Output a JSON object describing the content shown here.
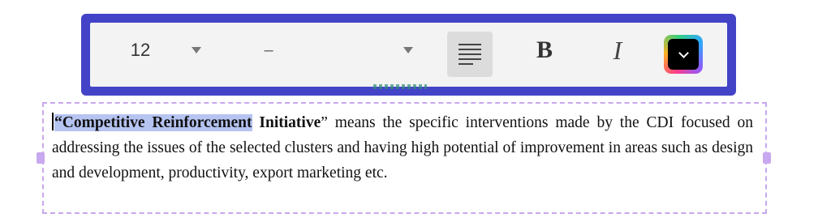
{
  "toolbar": {
    "font_size": "12",
    "font_family": "–",
    "bold_label": "B",
    "italic_label": "I",
    "accent_color": "#4343c8",
    "icons": [
      "chevron-down-icon",
      "align-left-icon",
      "color-picker-icon"
    ]
  },
  "paragraph": {
    "open_quote": "“",
    "selected_text": "Competitive Reinforcement",
    "bold_rest": " Initiative",
    "close_quote": "”",
    "body": " means the specific interventions made by the CDI focused on addressing the issues of the selected clusters and having high potential of improvement in areas such as design and development, productivity, export marketing etc."
  }
}
